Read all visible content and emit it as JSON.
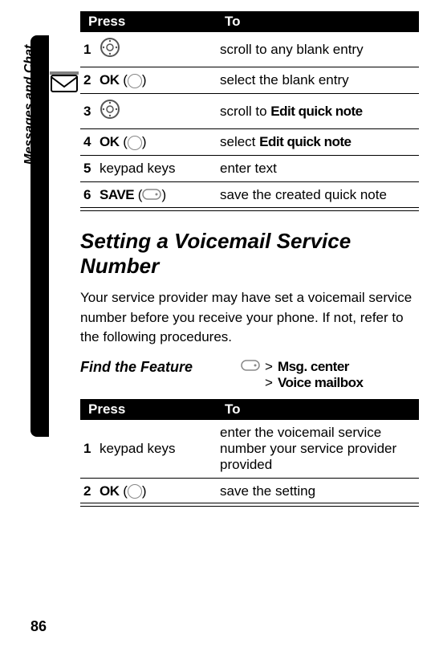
{
  "sideTab": {
    "label": "Messages and Chat"
  },
  "table1": {
    "header": {
      "press": "Press",
      "to": "To"
    },
    "rows": [
      {
        "num": "1",
        "keyType": "nav",
        "keyText": "",
        "action_pre": "scroll to any blank entry",
        "action_bold": ""
      },
      {
        "num": "2",
        "keyType": "circle",
        "keyText": "OK",
        "action_pre": "select the blank entry",
        "action_bold": ""
      },
      {
        "num": "3",
        "keyType": "nav",
        "keyText": "",
        "action_pre": "scroll to ",
        "action_bold": "Edit quick note"
      },
      {
        "num": "4",
        "keyType": "circle",
        "keyText": "OK",
        "action_pre": "select ",
        "action_bold": "Edit quick note"
      },
      {
        "num": "5",
        "keyType": "text",
        "keyText": "keypad keys",
        "action_pre": "enter text",
        "action_bold": ""
      },
      {
        "num": "6",
        "keyType": "softkey",
        "keyText": "SAVE",
        "action_pre": "save the created quick note",
        "action_bold": ""
      }
    ]
  },
  "section": {
    "title": "Setting a Voicemail Service Number",
    "body": "Your service provider may have set a voicemail service number before you receive your phone. If not, refer to the following procedures."
  },
  "feature": {
    "label": "Find the Feature",
    "path1_bold": "Msg. center",
    "path2_bold": "Voice mailbox",
    "gt": ">"
  },
  "table2": {
    "header": {
      "press": "Press",
      "to": "To"
    },
    "rows": [
      {
        "num": "1",
        "keyType": "text",
        "keyText": "keypad keys",
        "action_pre": "enter the voicemail service number your service provider provided",
        "action_bold": ""
      },
      {
        "num": "2",
        "keyType": "circle",
        "keyText": "OK",
        "action_pre": "save the setting",
        "action_bold": ""
      }
    ]
  },
  "pageNum": "86"
}
